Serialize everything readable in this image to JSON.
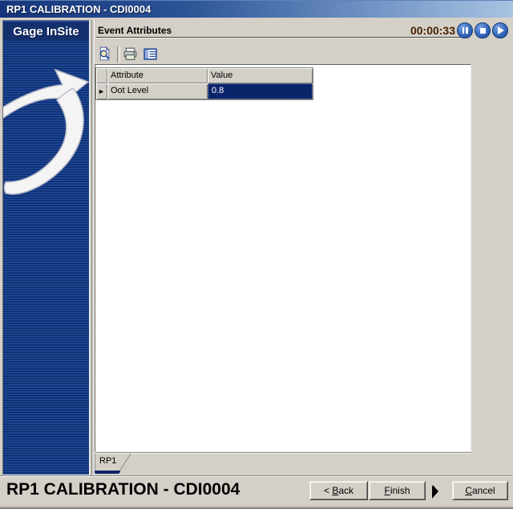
{
  "window": {
    "title": "RP1 CALIBRATION - CDI0004"
  },
  "sidebar": {
    "logo_text": "Gage InSite",
    "swoosh_icon": "swoosh-arrow-icon"
  },
  "panel": {
    "title": "Event Attributes",
    "timer": "00:00:33",
    "media_controls": [
      {
        "name": "pause"
      },
      {
        "name": "stop"
      },
      {
        "name": "play"
      }
    ]
  },
  "toolbar": {
    "buttons": [
      {
        "name": "print-preview"
      },
      {
        "name": "print"
      },
      {
        "name": "grid-view"
      }
    ]
  },
  "grid": {
    "columns": [
      "Attribute",
      "Value"
    ],
    "row_marker": "►",
    "rows": [
      {
        "attribute": "Oot Level",
        "value": "0.8"
      }
    ]
  },
  "tabs": [
    {
      "label": "RP1",
      "active": true
    }
  ],
  "footer": {
    "title": "RP1 CALIBRATION - CDI0004",
    "back_button": {
      "pre": "< ",
      "mnemonic": "B",
      "post": "ack"
    },
    "finish_button": {
      "pre": "",
      "mnemonic": "F",
      "post": "inish"
    },
    "cancel_button": {
      "pre": "",
      "mnemonic": "C",
      "post": "ancel"
    }
  },
  "colors": {
    "titlebar_left": "#16357a",
    "titlebar_right": "#a9c3e2",
    "sidebar_blue": "#1c4495",
    "sidebar_stripe": "#0d2a60",
    "logo_band": "#14316e",
    "selection_navy": "#0a246a",
    "timer_text": "#4a2104",
    "window_gray": "#d4d0c8",
    "media_button_blue": "#3567bd"
  }
}
